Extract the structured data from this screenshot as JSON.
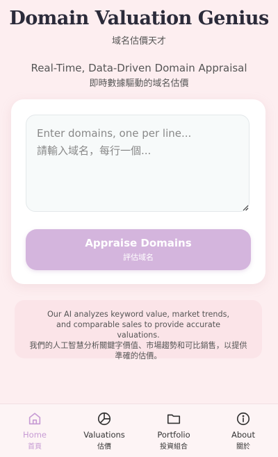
{
  "header": {
    "title": "Domain Valuation Genius",
    "subtitle_zh": "域名估價天才",
    "tagline": "Real-Time, Data-Driven Domain Appraisal",
    "tagline_zh": "即時數據驅動的域名估價"
  },
  "form": {
    "placeholder": "Enter domains, one per line...\n請輸入域名，每行一個...",
    "value": "",
    "button_label": "Appraise Domains",
    "button_label_zh": "評估域名",
    "button_color": "#d4b5dd"
  },
  "info": {
    "text_en": "Our AI analyzes keyword value, market trends, and comparable sales to provide accurate valuations.",
    "text_zh": "我們的人工智慧分析關鍵字價值、市場趨勢和可比銷售，以提供準確的估價。"
  },
  "nav": {
    "active_color": "#c79bd4",
    "items": [
      {
        "label": "Home",
        "label_zh": "首頁",
        "icon": "home-icon"
      },
      {
        "label": "Valuations",
        "label_zh": "估價",
        "icon": "pie-chart-icon"
      },
      {
        "label": "Portfolio",
        "label_zh": "投資組合",
        "icon": "folder-icon"
      },
      {
        "label": "About",
        "label_zh": "關於",
        "icon": "info-icon"
      }
    ]
  }
}
